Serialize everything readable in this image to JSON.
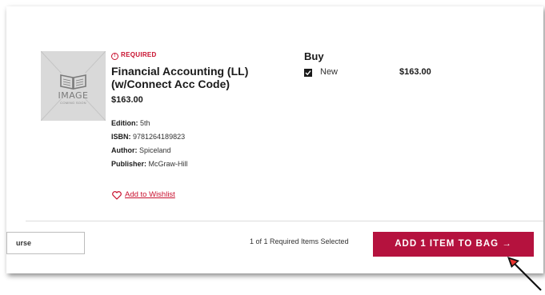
{
  "item": {
    "thumbnail": {
      "icon": "open-book-icon",
      "word": "IMAGE",
      "subtext": "COMING SOON"
    },
    "required_label": "REQUIRED",
    "required_icon": "exclamation-circle-icon",
    "title": "Financial Accounting (LL) (w/Connect Acc Code)",
    "price": "$163.00",
    "details": [
      {
        "label": "Edition:",
        "value": "5th"
      },
      {
        "label": "ISBN:",
        "value": "9781264189823"
      },
      {
        "label": "Author:",
        "value": "Spiceland"
      },
      {
        "label": "Publisher:",
        "value": "McGraw-Hill"
      }
    ],
    "wishlist_label": "Add to Wishlist",
    "wishlist_icon": "heart-icon"
  },
  "buy": {
    "heading": "Buy",
    "option_label": "New",
    "option_checked": true,
    "option_price": "$163.00"
  },
  "footer": {
    "course_button_label": "urse",
    "selected_text": "1 of 1 Required Items Selected",
    "add_button_label": "ADD 1 ITEM TO BAG →"
  },
  "colors": {
    "accent": "#b5123e",
    "required": "#c8102e"
  }
}
